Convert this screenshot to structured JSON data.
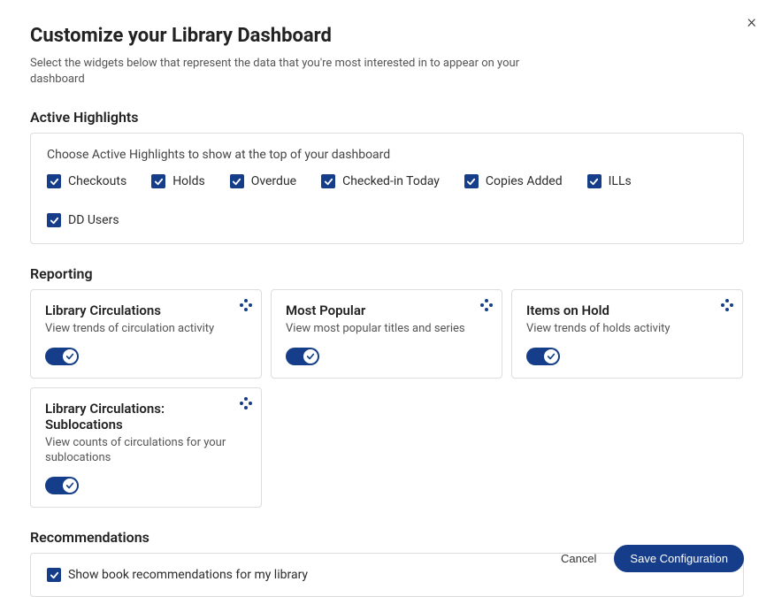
{
  "close_label": "×",
  "title": "Customize your Library Dashboard",
  "description": "Select the widgets below that represent the data that you're most interested in to appear on your dashboard",
  "highlights": {
    "section_title": "Active Highlights",
    "panel_desc": "Choose Active Highlights to show at the top of your dashboard",
    "items": [
      {
        "label": "Checkouts",
        "checked": true
      },
      {
        "label": "Holds",
        "checked": true
      },
      {
        "label": "Overdue",
        "checked": true
      },
      {
        "label": "Checked-in Today",
        "checked": true
      },
      {
        "label": "Copies Added",
        "checked": true
      },
      {
        "label": "ILLs",
        "checked": true
      },
      {
        "label": "DD Users",
        "checked": true
      }
    ]
  },
  "reporting": {
    "section_title": "Reporting",
    "cards": [
      {
        "title": "Library Circulations",
        "desc": "View trends of circulation activity",
        "on": true
      },
      {
        "title": "Most Popular",
        "desc": "View most popular titles and series",
        "on": true
      },
      {
        "title": "Items on Hold",
        "desc": "View trends of holds activity",
        "on": true
      },
      {
        "title": "Library Circulations: Sublocations",
        "desc": "View counts of circulations for your sublocations",
        "on": true
      }
    ]
  },
  "recommendations": {
    "section_title": "Recommendations",
    "label": "Show book recommendations for my library",
    "checked": true
  },
  "footer": {
    "cancel": "Cancel",
    "save": "Save Configuration"
  }
}
